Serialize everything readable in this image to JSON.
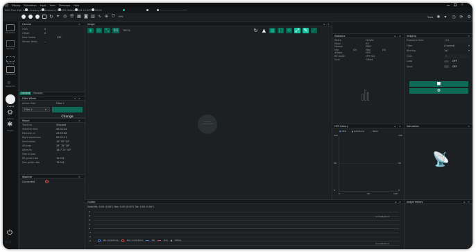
{
  "menu": [
    "Display",
    "Simulation",
    "Input",
    "Tools",
    "Telescope",
    "Help"
  ],
  "window_title": "NGO Plus   High focus Imaging  W  Astronomy  0.1 HFD     Default 2024-10-30T17:09:00",
  "toolbar": {
    "image_label": "Info",
    "tools_label": "Tools"
  },
  "leftnav": [
    {
      "label": "Equipment"
    },
    {
      "label": "Sky Atlas"
    },
    {
      "label": "Framing"
    },
    {
      "label": "Flat Wizard"
    },
    {
      "label": "Sequencer"
    },
    {
      "label": "Imaging"
    },
    {
      "label": "Options"
    },
    {
      "label": "Plugins"
    }
  ],
  "camera": {
    "title": "Camera",
    "rows": [
      {
        "k": "Gain",
        "v": "0"
      },
      {
        "k": "Offset",
        "v": "0"
      },
      {
        "k": "Dew heater",
        "v": "OFF"
      },
      {
        "k": "Sensor temp.",
        "v": "--"
      }
    ],
    "tabs": [
      "Camera",
      "Focuser"
    ]
  },
  "filter_wheel": {
    "title": "Filter Wheel",
    "active_label": "Active filter",
    "active_value": "Filter 2",
    "select_value": "Filter 2",
    "change_label": "Change"
  },
  "mount": {
    "title": "Mount",
    "rows": [
      {
        "k": "Tracking",
        "v": "Stopped"
      },
      {
        "k": "Sidereal time",
        "v": "00:02:24"
      },
      {
        "k": "Meridian in",
        "v": "23:59:08"
      },
      {
        "k": "Right Ascension",
        "v": "00:01:11"
      },
      {
        "k": "Declination",
        "v": "10° 00' 25\""
      },
      {
        "k": "Altitude",
        "v": "26° 39' 28\""
      },
      {
        "k": "Azimuth",
        "v": "181° 25' 43\""
      },
      {
        "k": "Side of pier",
        "v": ""
      },
      {
        "k": "RA guide rate",
        "v": "15.041"
      },
      {
        "k": "Dec guide rate",
        "v": "15.041"
      }
    ]
  },
  "weather": {
    "title": "Weather",
    "connected_label": "Connected"
  },
  "image": {
    "title": "Image",
    "zoom_11": "1:1",
    "zoom_pct": "100 %"
  },
  "statistics": {
    "title": "Statistics",
    "left": [
      {
        "k": "Width",
        "v": ""
      },
      {
        "k": "Mean",
        "v": ""
      },
      {
        "k": "Median",
        "v": ""
      },
      {
        "k": "Min",
        "v": "(0)"
      },
      {
        "k": "#Stars",
        "v": ""
      },
      {
        "k": "Bit depth",
        "v": ""
      },
      {
        "k": "Gain",
        "v": ""
      }
    ],
    "right": [
      {
        "k": "Height",
        "v": ""
      },
      {
        "k": "SD",
        "v": ""
      },
      {
        "k": "MAD",
        "v": ""
      },
      {
        "k": "Max",
        "v": "(0)"
      },
      {
        "k": "HFR",
        "v": ""
      },
      {
        "k": "HFR SD",
        "v": ""
      },
      {
        "k": "Offset",
        "v": ""
      }
    ]
  },
  "imaging": {
    "title": "Imaging",
    "rows": [
      {
        "k": "Exposure time",
        "v": "1 s"
      },
      {
        "k": "Filter",
        "v": "(Current)"
      },
      {
        "k": "Binning",
        "v": "1x1"
      },
      {
        "k": "Gain",
        "v": "0"
      },
      {
        "k": "Loop",
        "v": "OFF"
      },
      {
        "k": "Save",
        "v": "OFF"
      }
    ]
  },
  "hfr_history": {
    "title": "HFR history",
    "legend": [
      "HFR",
      "Autofocus",
      "Stars"
    ],
    "y_left": [
      "100",
      "50",
      "0"
    ],
    "y_right": [
      "100",
      "50",
      "0"
    ],
    "x_ticks": [
      "0",
      "50",
      "100"
    ]
  },
  "saturation": {
    "title": "Saturation"
  },
  "guider": {
    "title": "Guider",
    "state_line": "State   RA: 0.00 (0.00\")  Dec: 0.00 (0.00\")  Tot: 0.00 (0.00\")",
    "y_ticks": [
      "4",
      "3",
      "2",
      "1",
      "0",
      "-1",
      "-2",
      "-3",
      "-4"
    ],
    "legend": [
      "RA corrections",
      "Dec corrections",
      "RA",
      "Dec",
      "Dither"
    ],
    "scale_top": "GuideMethod",
    "scale_bottom": "GuideMethod"
  },
  "image_history": {
    "title": "Image history"
  },
  "colors": {
    "accent": "#0f6b58",
    "teal_icon": "#19c4a0",
    "warning_red": "#e0443a",
    "hfr_blue": "#4b86d6",
    "ra_blue": "#3a78d8",
    "dec_red": "#d8453a"
  }
}
